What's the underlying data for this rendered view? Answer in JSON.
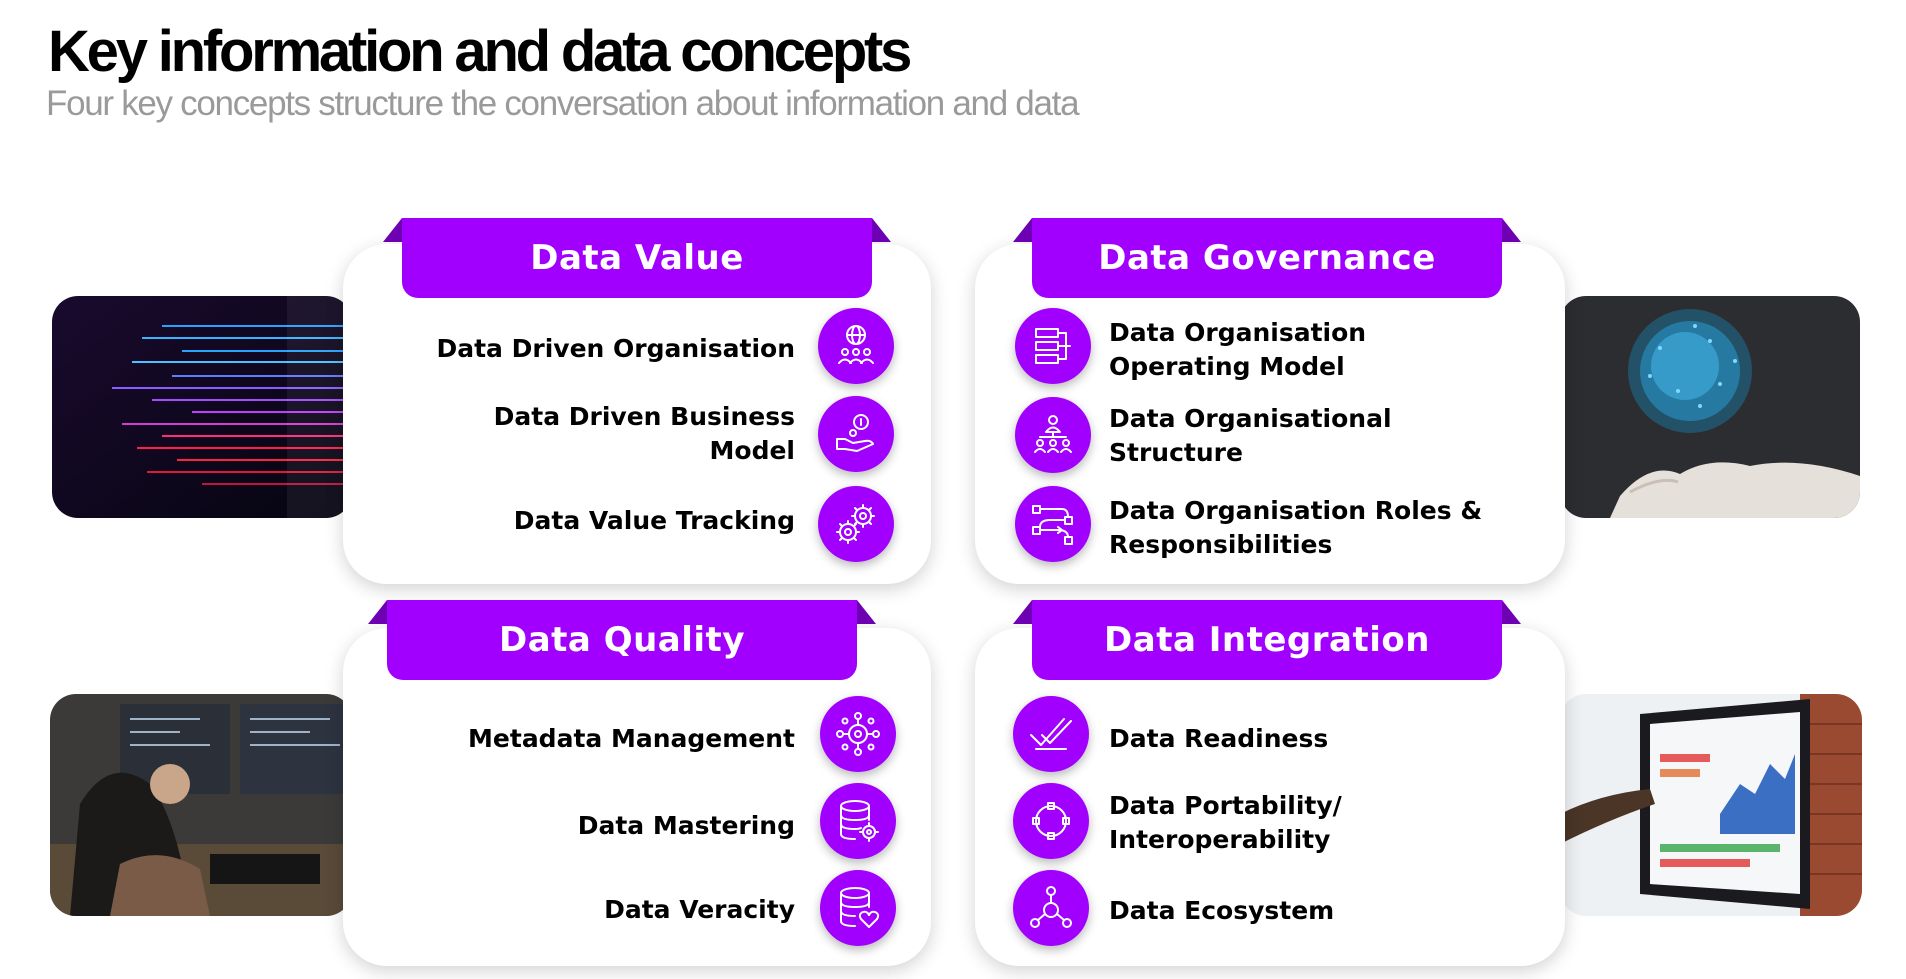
{
  "header": {
    "title": "Key information and data concepts",
    "subtitle": "Four key concepts structure the conversation about information and data"
  },
  "colors": {
    "accent": "#a100ff",
    "accent_dark": "#6e00b4",
    "subtitle_gray": "#9a9a9a"
  },
  "quadrants": {
    "value": {
      "title": "Data Value",
      "items": [
        {
          "label": "Data Driven Organisation",
          "icon": "globe-people-icon"
        },
        {
          "label": "Data Driven  Business Model",
          "icon": "hand-coin-icon"
        },
        {
          "label": "Data Value Tracking",
          "icon": "gears-icon"
        }
      ]
    },
    "governance": {
      "title": "Data Governance",
      "items": [
        {
          "label": "Data Organisation Operating Model",
          "icon": "org-chart-icon"
        },
        {
          "label": "Data Organisational Structure",
          "icon": "hierarchy-icon"
        },
        {
          "label": "Data Organisation Roles & Responsibilities",
          "icon": "workflow-icon"
        }
      ]
    },
    "quality": {
      "title": "Data Quality",
      "items": [
        {
          "label": "Metadata Management",
          "icon": "network-node-icon"
        },
        {
          "label": "Data Mastering",
          "icon": "database-gear-icon"
        },
        {
          "label": "Data Veracity",
          "icon": "database-heart-icon"
        }
      ]
    },
    "integration": {
      "title": "Data Integration",
      "items": [
        {
          "label": "Data Readiness",
          "icon": "double-check-icon"
        },
        {
          "label": "Data Portability/ Interoperability",
          "icon": "cycle-icon"
        },
        {
          "label": "Data Ecosystem",
          "icon": "ecosystem-icon"
        }
      ]
    }
  },
  "photos": {
    "top_left": "light-streams-photo",
    "top_right": "data-sphere-hand-photo",
    "bottom_left": "developer-at-monitors-photo",
    "bottom_right": "dashboard-screen-photo"
  }
}
